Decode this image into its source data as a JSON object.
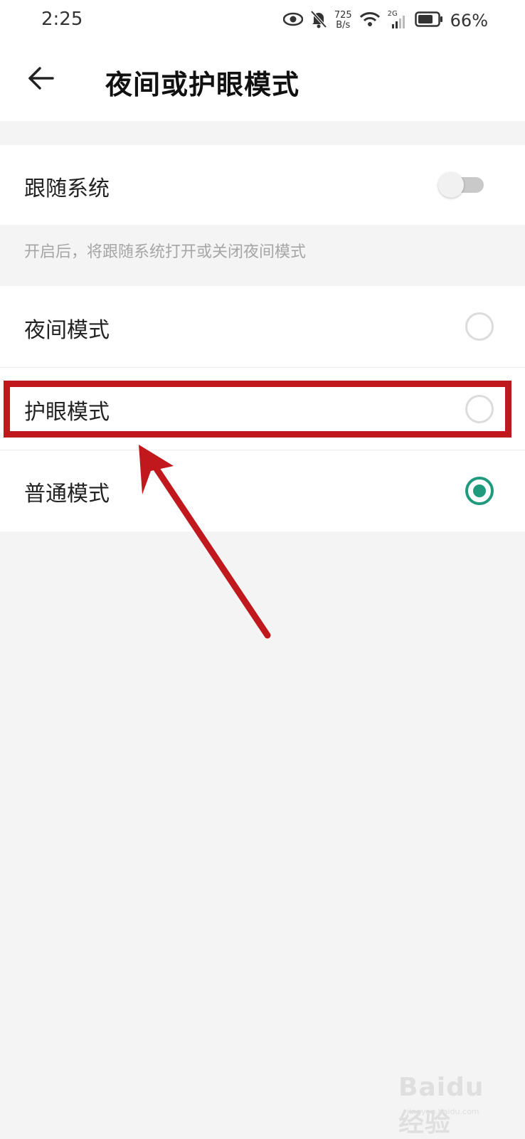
{
  "status_bar": {
    "time": "2:25",
    "speed_value": "725",
    "speed_unit": "B/s",
    "network": "2G",
    "battery": "66%"
  },
  "header": {
    "title": "夜间或护眼模式",
    "back_icon": "back-arrow-icon"
  },
  "follow_system": {
    "label": "跟随系统",
    "enabled": false,
    "helper": "开启后，将跟随系统打开或关闭夜间模式"
  },
  "modes": [
    {
      "label": "夜间模式",
      "selected": false
    },
    {
      "label": "护眼模式",
      "selected": false
    },
    {
      "label": "普通模式",
      "selected": true
    }
  ],
  "colors": {
    "accent": "#1f9a7d",
    "highlight": "#c0181d",
    "background": "#f4f4f4"
  },
  "watermark": {
    "brand": "Baidu 经验",
    "url": "jingyan.baidu.com"
  }
}
